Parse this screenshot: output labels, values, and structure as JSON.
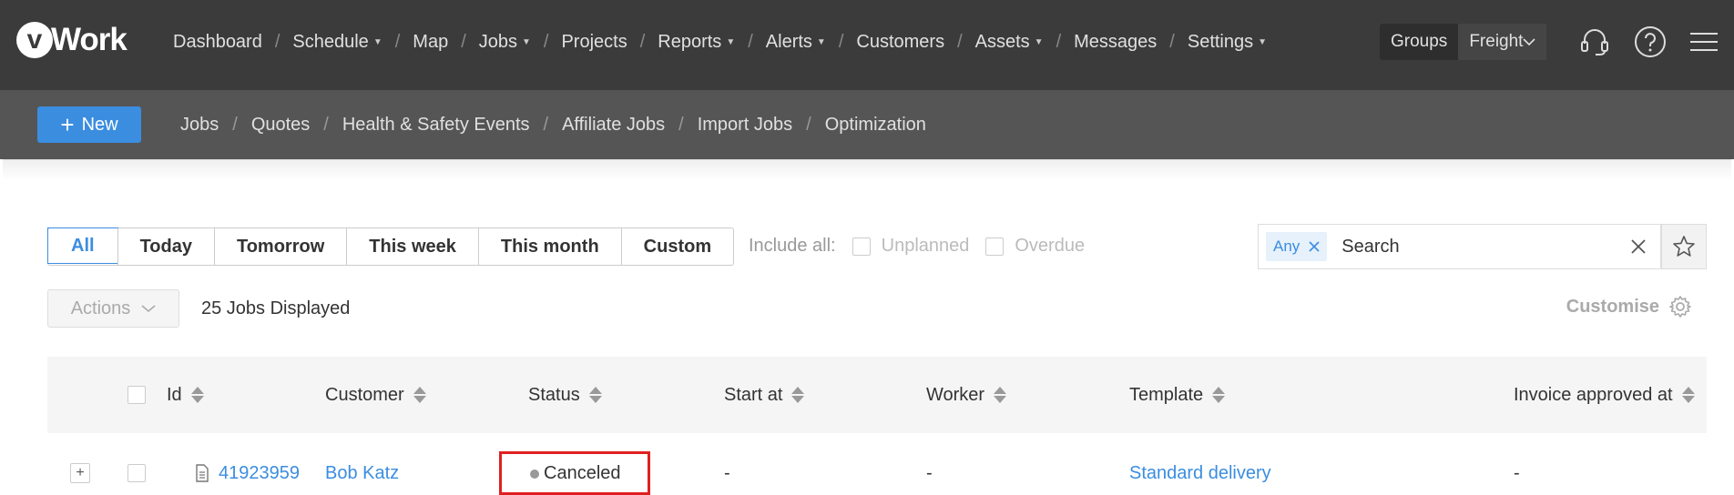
{
  "app": {
    "logo_letter": "v",
    "logo_text": "Work"
  },
  "main_nav": [
    {
      "label": "Dashboard",
      "dropdown": false
    },
    {
      "label": "Schedule",
      "dropdown": true
    },
    {
      "label": "Map",
      "dropdown": false
    },
    {
      "label": "Jobs",
      "dropdown": true
    },
    {
      "label": "Projects",
      "dropdown": false
    },
    {
      "label": "Reports",
      "dropdown": true
    },
    {
      "label": "Alerts",
      "dropdown": true
    },
    {
      "label": "Customers",
      "dropdown": false
    },
    {
      "label": "Assets",
      "dropdown": true
    },
    {
      "label": "Messages",
      "dropdown": false
    },
    {
      "label": "Settings",
      "dropdown": true
    }
  ],
  "groups": {
    "label": "Groups",
    "value": "Freight"
  },
  "top_icons": [
    "headset-icon",
    "help-icon",
    "hamburger-menu-icon"
  ],
  "subbar": {
    "new_label": "New",
    "items": [
      "Jobs",
      "Quotes",
      "Health & Safety Events",
      "Affiliate Jobs",
      "Import Jobs",
      "Optimization"
    ]
  },
  "filters": {
    "buttons": [
      "All",
      "Today",
      "Tomorrow",
      "This week",
      "This month",
      "Custom"
    ],
    "active": "All",
    "include_all_label": "Include all:",
    "checkbox_unplanned": "Unplanned",
    "checkbox_overdue": "Overdue"
  },
  "search": {
    "tag": "Any",
    "placeholder": "Search"
  },
  "toolbar": {
    "actions_label": "Actions",
    "jobs_count": "25 Jobs Displayed",
    "customise_label": "Customise"
  },
  "table": {
    "columns": {
      "id": "Id",
      "customer": "Customer",
      "status": "Status",
      "start_at": "Start at",
      "worker": "Worker",
      "template": "Template",
      "invoice_approved_at": "Invoice approved at"
    },
    "rows": [
      {
        "id": "41923959",
        "customer": "Bob Katz",
        "status": "Canceled",
        "start_at": "-",
        "worker": "-",
        "template": "Standard delivery",
        "invoice_approved_at": "-"
      }
    ]
  },
  "colors": {
    "accent": "#3b8de0",
    "topbar": "#3b3b3b",
    "subbar": "#555555",
    "highlight": "#e02020"
  }
}
